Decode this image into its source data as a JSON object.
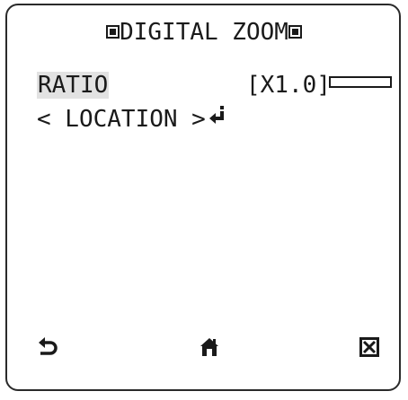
{
  "menu": {
    "title": "DIGITAL ZOOM",
    "ratio": {
      "label": "RATIO",
      "value": "[X1.0]"
    },
    "location": {
      "label": "< LOCATION >"
    }
  },
  "icons": {
    "title_left": "square-marker-icon",
    "title_right": "square-marker-icon",
    "enter": "enter-return-icon",
    "back": "back-arrow-icon",
    "home": "home-icon",
    "close": "close-box-icon"
  }
}
